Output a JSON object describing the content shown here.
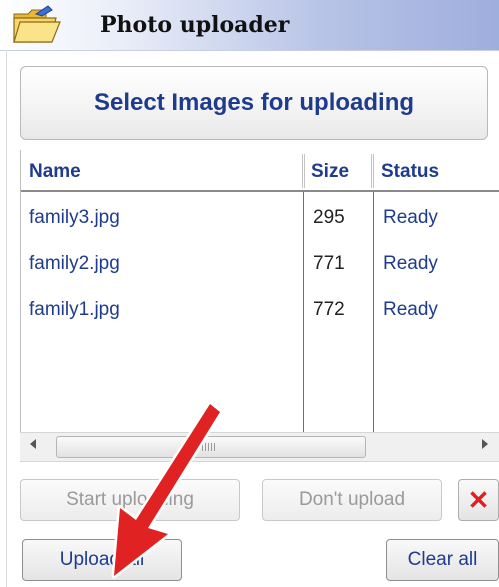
{
  "window": {
    "title": "Photo uploader",
    "icon": "folder-open-icon"
  },
  "select_button": {
    "label": "Select Images for uploading"
  },
  "file_list": {
    "columns": [
      "Name",
      "Size",
      "Status"
    ],
    "rows": [
      {
        "name": "family3.jpg",
        "size": "295",
        "status": "Ready"
      },
      {
        "name": "family2.jpg",
        "size": "771",
        "status": "Ready"
      },
      {
        "name": "family1.jpg",
        "size": "772",
        "status": "Ready"
      }
    ]
  },
  "buttons": {
    "start_uploading": "Start uploading",
    "dont_upload": "Don't upload",
    "remove": "✕",
    "upload_all": "Upload all",
    "clear_all": "Clear all"
  },
  "annotation": {
    "icon": "red-arrow-icon",
    "color": "#e02222"
  },
  "colors": {
    "accent_text": "#1f3b8e",
    "remove_red": "#e02020"
  }
}
